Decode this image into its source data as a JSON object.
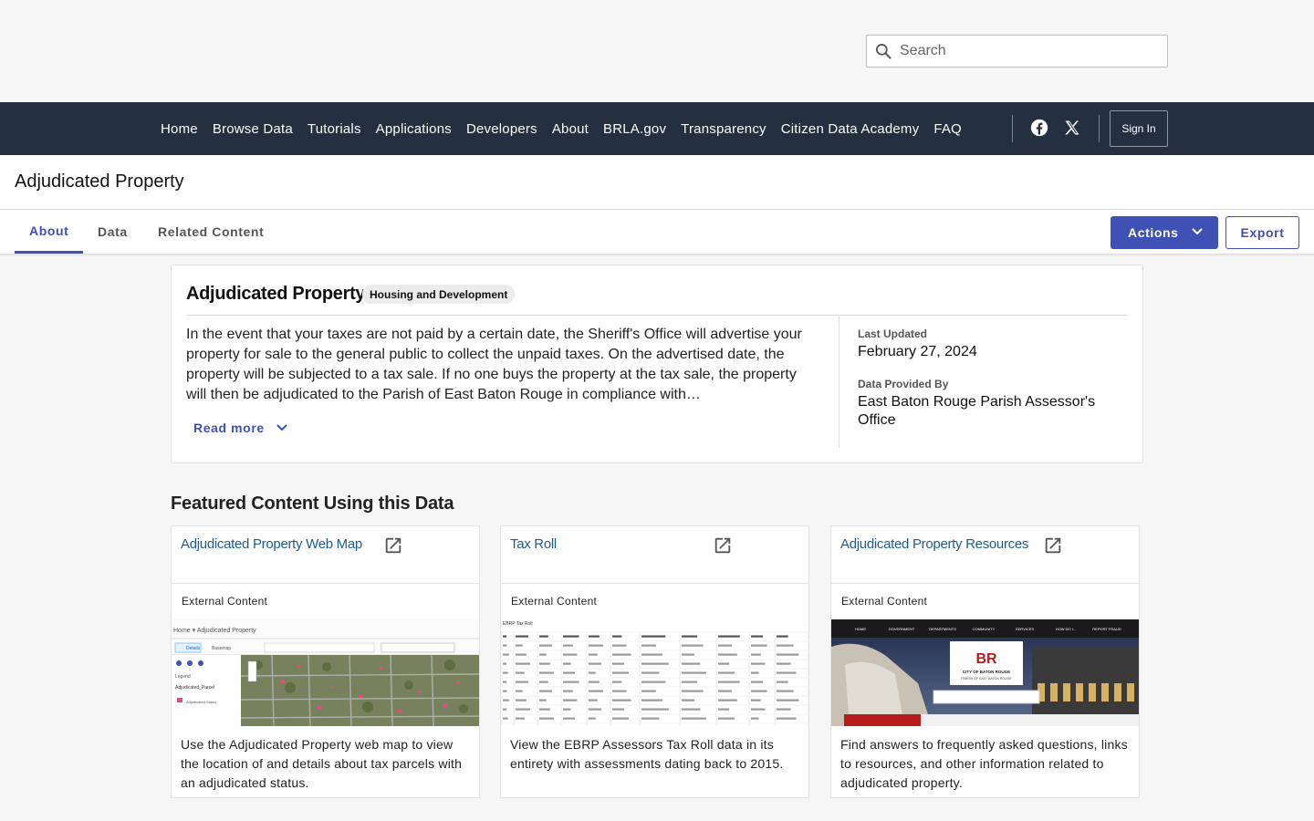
{
  "search": {
    "placeholder": "Search"
  },
  "nav": {
    "links": [
      "Home",
      "Browse Data",
      "Tutorials",
      "Applications",
      "Developers",
      "About",
      "BRLA.gov",
      "Transparency",
      "Citizen Data Academy",
      "FAQ"
    ],
    "sign_in": "Sign In"
  },
  "page": {
    "title": "Adjudicated Property"
  },
  "tabs": {
    "items": [
      "About",
      "Data",
      "Related Content"
    ],
    "active": "About",
    "actions_label": "Actions",
    "export_label": "Export"
  },
  "about": {
    "title": "Adjudicated Property",
    "category": "Housing and Development",
    "description": "In the event that your taxes are not paid by a certain date, the Sheriff's Office will advertise your property for sale to the general public to collect the unpaid taxes. On the advertised date, the property will be subjected to a tax sale. If no one buys the property at the tax sale, the property will then be adjudicated to the Parish of East Baton Rouge in compliance with…",
    "read_more": "Read more",
    "last_updated_label": "Last Updated",
    "last_updated": "February 27, 2024",
    "provided_by_label": "Data Provided By",
    "provided_by": "East Baton Rouge Parish Assessor's Office"
  },
  "featured": {
    "heading": "Featured Content Using this Data",
    "cards": [
      {
        "title": "Adjudicated Property Web Map",
        "type": "External Content",
        "description": "Use the Adjudicated Property web map to view the location of and details about tax parcels with an adjudicated status."
      },
      {
        "title": "Tax Roll",
        "type": "External Content",
        "description": "View the EBRP Assessors Tax Roll data in its entirety with assessments dating back to 2015."
      },
      {
        "title": "Adjudicated Property Resources",
        "type": "External Content",
        "description": "Find answers to frequently asked questions, links to resources, and other information related to adjudicated property."
      }
    ]
  },
  "thumbs": {
    "map_breadcrumb": "Home ▾  Adjudicated Property",
    "map_tabs": [
      "Details",
      "Basemap"
    ],
    "map_legend": "Legend",
    "map_layer": "Adjudicated_Parcel",
    "map_layer_sub": "Adjudicated Status",
    "taxroll_title": "EBRP Tax Roll",
    "br_logo": "BR",
    "br_city": "CITY OF BATON ROUGE",
    "br_parish": "PARISH OF EAST BATON ROUGE",
    "br_nav": [
      "HOME",
      "GOVERNMENT",
      "DEPARTMENTS",
      "COMMUNITY",
      "SERVICES",
      "HOW DO I...",
      "REPORT FRAUD"
    ]
  },
  "colors": {
    "nav_bg": "#24303f",
    "primary": "#3f51b5",
    "link": "#1e5c8a"
  }
}
